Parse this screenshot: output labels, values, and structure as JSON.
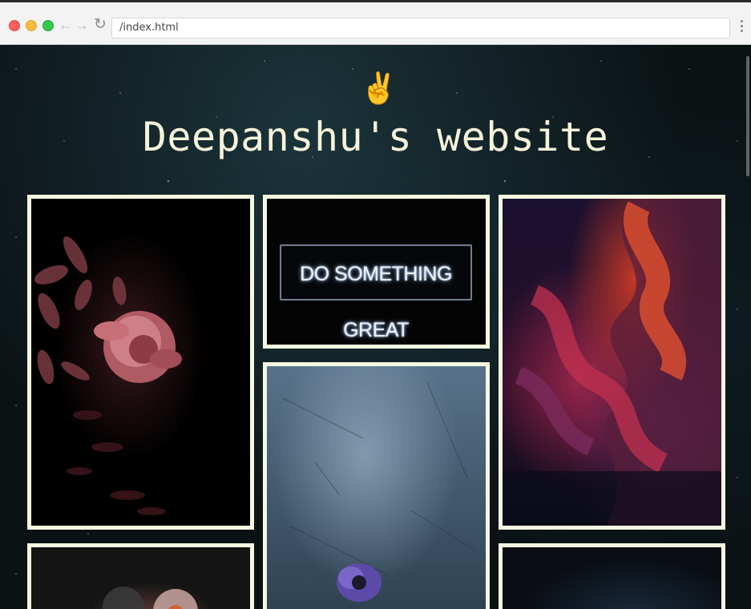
{
  "browser": {
    "address": "/index.html",
    "back_icon": "←",
    "forward_icon": "→",
    "reload_icon": "↻"
  },
  "page": {
    "emoji": "✌️",
    "title": "Deepanshu's website"
  },
  "gallery": {
    "neon_sign_text": "DO SOMETHING GREAT"
  },
  "colors": {
    "title": "#f5f3da",
    "card_border": "#f5f7e1"
  }
}
